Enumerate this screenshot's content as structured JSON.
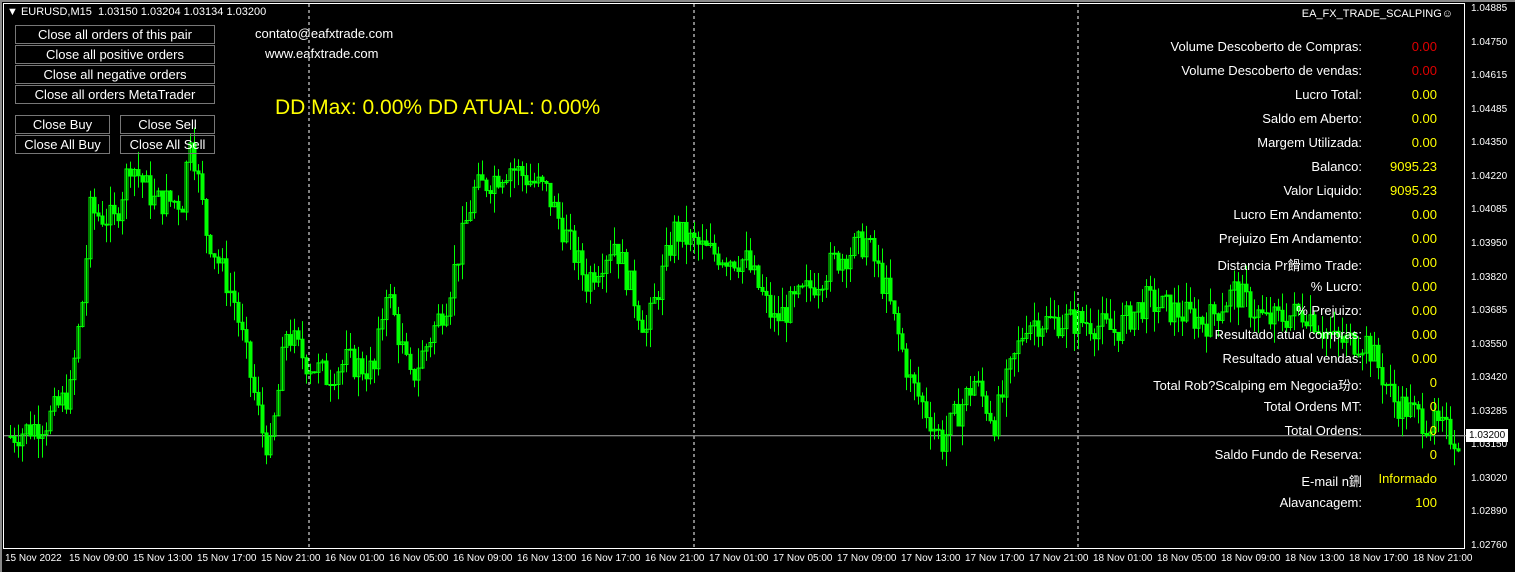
{
  "header": {
    "symbol": "EURUSD,M15",
    "ohlc": "1.03150 1.03204 1.03134 1.03200",
    "ea_name": "EA_FX_TRADE_SCALPING",
    "ea_icon": "smiley-icon"
  },
  "buttons": [
    {
      "label": "Close all orders of this pair",
      "bg": "#008000",
      "fg": "#ffffff"
    },
    {
      "label": "Close all positive orders",
      "bg": "#0000ff",
      "fg": "#ffffff"
    },
    {
      "label": "Close all negative orders",
      "bg": "#ff0000",
      "fg": "#ffffff"
    },
    {
      "label": "Close all orders MetaTrader",
      "bg": "#ffff00",
      "fg": "#000000"
    },
    {
      "label": "Close Buy",
      "bg": "#1e90ff",
      "fg": "#ffffff"
    },
    {
      "label": "Close Sell",
      "bg": "#ff4500",
      "fg": "#000000"
    },
    {
      "label": "Close All Buy",
      "bg": "#ffff00",
      "fg": "#000000"
    },
    {
      "label": "Close All Sell",
      "bg": "#ffff00",
      "fg": "#000000"
    }
  ],
  "contact": {
    "email": "contato@eafxtrade.com",
    "site": "www.eafxtrade.com"
  },
  "dd_text": "DD Max: 0.00% DD ATUAL: 0.00%",
  "stats": [
    {
      "label": "Volume Descoberto de Compras:",
      "value": "0.00",
      "color": "#e00000"
    },
    {
      "label": "Volume Descoberto de vendas:",
      "value": "0.00",
      "color": "#e00000"
    },
    {
      "label": "Lucro Total:",
      "value": "0.00",
      "color": "#ffff00"
    },
    {
      "label": "Saldo em Aberto:",
      "value": "0.00",
      "color": "#ffff00"
    },
    {
      "label": "Margem Utilizada:",
      "value": "0.00",
      "color": "#ffff00"
    },
    {
      "label": "Balanco:",
      "value": "9095.23",
      "color": "#ffff00"
    },
    {
      "label": "Valor Liquido:",
      "value": "9095.23",
      "color": "#ffff00"
    },
    {
      "label": "Lucro Em Andamento:",
      "value": "0.00",
      "color": "#ffff00"
    },
    {
      "label": "Prejuizo Em Andamento:",
      "value": "0.00",
      "color": "#ffff00"
    },
    {
      "label": "Distancia Pr餶imo Trade:",
      "value": "0.00",
      "color": "#ffff00"
    },
    {
      "label": "% Lucro:",
      "value": "0.00",
      "color": "#ffff00"
    },
    {
      "label": "% Prejuizo:",
      "value": "0.00",
      "color": "#ffff00"
    },
    {
      "label": "Resultado atual compras:",
      "value": "0.00",
      "color": "#ffff00"
    },
    {
      "label": "Resultado atual vendas:",
      "value": "0.00",
      "color": "#ffff00"
    },
    {
      "label": "Total Rob?Scalping em Negocia玢o:",
      "value": "0",
      "color": "#ffff00"
    },
    {
      "label": "Total Ordens MT:",
      "value": "0",
      "color": "#ffff00"
    },
    {
      "label": "Total Ordens:",
      "value": "0",
      "color": "#ffff00"
    },
    {
      "label": "Saldo Fundo de Reserva:",
      "value": "0",
      "color": "#ffff00"
    },
    {
      "label": "E-mail n鉶",
      "value": "Informado",
      "color": "#ffff00"
    },
    {
      "label": "Alavancagem:",
      "value": "100",
      "color": "#ffff00"
    }
  ],
  "price_axis": [
    "1.04885",
    "1.04750",
    "1.04615",
    "1.04485",
    "1.04350",
    "1.04220",
    "1.04085",
    "1.03950",
    "1.03820",
    "1.03685",
    "1.03550",
    "1.03420",
    "1.03285",
    "1.03150",
    "1.03020",
    "1.02890",
    "1.02760"
  ],
  "current_price": "1.03200",
  "time_axis": [
    "15 Nov 2022",
    "15 Nov 09:00",
    "15 Nov 13:00",
    "15 Nov 17:00",
    "15 Nov 21:00",
    "16 Nov 01:00",
    "16 Nov 05:00",
    "16 Nov 09:00",
    "16 Nov 13:00",
    "16 Nov 17:00",
    "16 Nov 21:00",
    "17 Nov 01:00",
    "17 Nov 05:00",
    "17 Nov 09:00",
    "17 Nov 13:00",
    "17 Nov 17:00",
    "17 Nov 21:00",
    "18 Nov 01:00",
    "18 Nov 05:00",
    "18 Nov 09:00",
    "18 Nov 13:00",
    "18 Nov 17:00",
    "18 Nov 21:00"
  ],
  "chart_data": {
    "type": "candlestick",
    "color": "#00ff00",
    "price_range": [
      1.0276,
      1.04885
    ],
    "path": [
      [
        1,
        1.03198
      ],
      [
        10,
        1.03257
      ],
      [
        16,
        1.03376
      ],
      [
        19,
        1.03733
      ],
      [
        21,
        1.04089
      ],
      [
        27,
        1.04049
      ],
      [
        31,
        1.04287
      ],
      [
        37,
        1.04129
      ],
      [
        44,
        1.04129
      ],
      [
        46,
        1.04406
      ],
      [
        50,
        1.0401
      ],
      [
        57,
        1.03733
      ],
      [
        64,
        1.03218
      ],
      [
        66,
        1.03139
      ],
      [
        70,
        1.03614
      ],
      [
        75,
        1.03495
      ],
      [
        80,
        1.03436
      ],
      [
        85,
        1.03495
      ],
      [
        92,
        1.03455
      ],
      [
        95,
        1.03792
      ],
      [
        101,
        1.03416
      ],
      [
        110,
        1.03733
      ],
      [
        117,
        1.04168
      ],
      [
        126,
        1.04267
      ],
      [
        135,
        1.04168
      ],
      [
        145,
        1.03812
      ],
      [
        152,
        1.0397
      ],
      [
        160,
        1.03614
      ],
      [
        167,
        1.0401
      ],
      [
        175,
        1.03931
      ],
      [
        185,
        1.03891
      ],
      [
        192,
        1.03653
      ],
      [
        200,
        1.03772
      ],
      [
        207,
        1.03891
      ],
      [
        215,
        1.0397
      ],
      [
        220,
        1.03772
      ],
      [
        226,
        1.03416
      ],
      [
        234,
        1.03178
      ],
      [
        242,
        1.03416
      ],
      [
        247,
        1.03257
      ],
      [
        255,
        1.03653
      ],
      [
        270,
        1.03653
      ],
      [
        277,
        1.03614
      ],
      [
        285,
        1.03733
      ],
      [
        292,
        1.03693
      ],
      [
        300,
        1.03653
      ],
      [
        307,
        1.03772
      ],
      [
        315,
        1.03653
      ],
      [
        325,
        1.03693
      ],
      [
        332,
        1.03574
      ],
      [
        340,
        1.03574
      ],
      [
        347,
        1.03337
      ],
      [
        355,
        1.03257
      ],
      [
        364,
        1.03178
      ]
    ]
  }
}
